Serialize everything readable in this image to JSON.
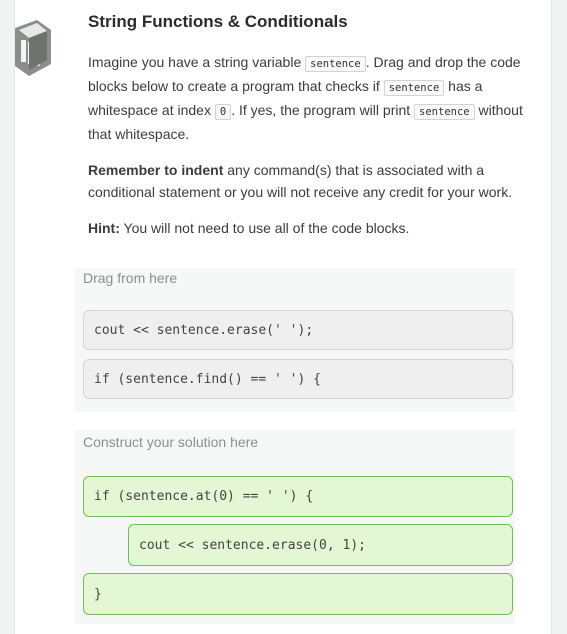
{
  "title": "String Functions & Conditionals",
  "intro": {
    "t1": "Imagine you have a string variable ",
    "c1": "sentence",
    "t2": ". Drag and drop the code blocks below to create a program that checks if ",
    "c2": "sentence",
    "t3": " has a whitespace at index ",
    "c3": "0",
    "t4": ". If yes, the program will print ",
    "c4": "sentence",
    "t5": " without that whitespace."
  },
  "remember": {
    "bold": "Remember to indent",
    "rest": " any command(s) that is associated with a conditional statement or you will not receive any credit for your work."
  },
  "hint": {
    "bold": "Hint:",
    "rest": " You will not need to use all of the code blocks."
  },
  "drag_area": {
    "label": "Drag from here",
    "blocks": [
      "cout << sentence.erase(' ');",
      "if (sentence.find() == ' ') {"
    ]
  },
  "solution_area": {
    "label": "Construct your solution here",
    "blocks": [
      "if (sentence.at(0) == ' ') {",
      "cout << sentence.erase(0, 1);",
      "}"
    ]
  },
  "colors": {
    "solution_block_bg": "#e3f7d4",
    "solution_block_border": "#6fbf55",
    "source_block_bg": "#efefef"
  }
}
